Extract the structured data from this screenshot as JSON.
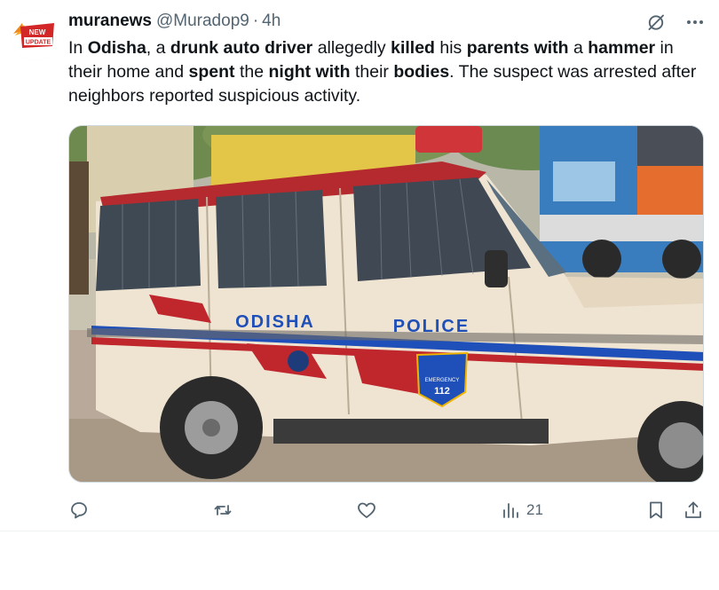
{
  "tweet": {
    "author_name": "muranews",
    "author_handle": "@Muradop9",
    "separator": "·",
    "time": "4h",
    "avatar_badge_line1": "NEW",
    "avatar_badge_line2": "UPDATE",
    "text_segments": [
      {
        "t": "In ",
        "b": false
      },
      {
        "t": "Odisha",
        "b": true
      },
      {
        "t": ", a ",
        "b": false
      },
      {
        "t": "drunk auto driver",
        "b": true
      },
      {
        "t": " allegedly ",
        "b": false
      },
      {
        "t": "killed",
        "b": true
      },
      {
        "t": " his ",
        "b": false
      },
      {
        "t": "parents with",
        "b": true
      },
      {
        "t": " a ",
        "b": false
      },
      {
        "t": "hammer",
        "b": true
      },
      {
        "t": " in their home and ",
        "b": false
      },
      {
        "t": "spent",
        "b": true
      },
      {
        "t": " the ",
        "b": false
      },
      {
        "t": "night with",
        "b": true
      },
      {
        "t": " their ",
        "b": false
      },
      {
        "t": "bodies",
        "b": true
      },
      {
        "t": ". The suspect was arrested after neighbors reported suspicious activity.",
        "b": false
      }
    ],
    "media": {
      "door_left_text": "ODISHA",
      "door_right_text": "POLICE",
      "emblem_number": "112",
      "emblem_caption": "EMERGENCY"
    },
    "stats": {
      "views": "21"
    }
  },
  "icons": {
    "grok": "grok-icon",
    "more": "more-icon",
    "reply": "reply-icon",
    "retweet": "retweet-icon",
    "like": "like-icon",
    "views": "views-icon",
    "bookmark": "bookmark-icon",
    "share": "share-icon"
  },
  "colors": {
    "text": "#0f1419",
    "muted": "#536471",
    "border": "#cfd9de",
    "police_blue": "#1f4fb8",
    "police_red": "#c0272d",
    "vehicle_cream": "#efe4d2"
  }
}
